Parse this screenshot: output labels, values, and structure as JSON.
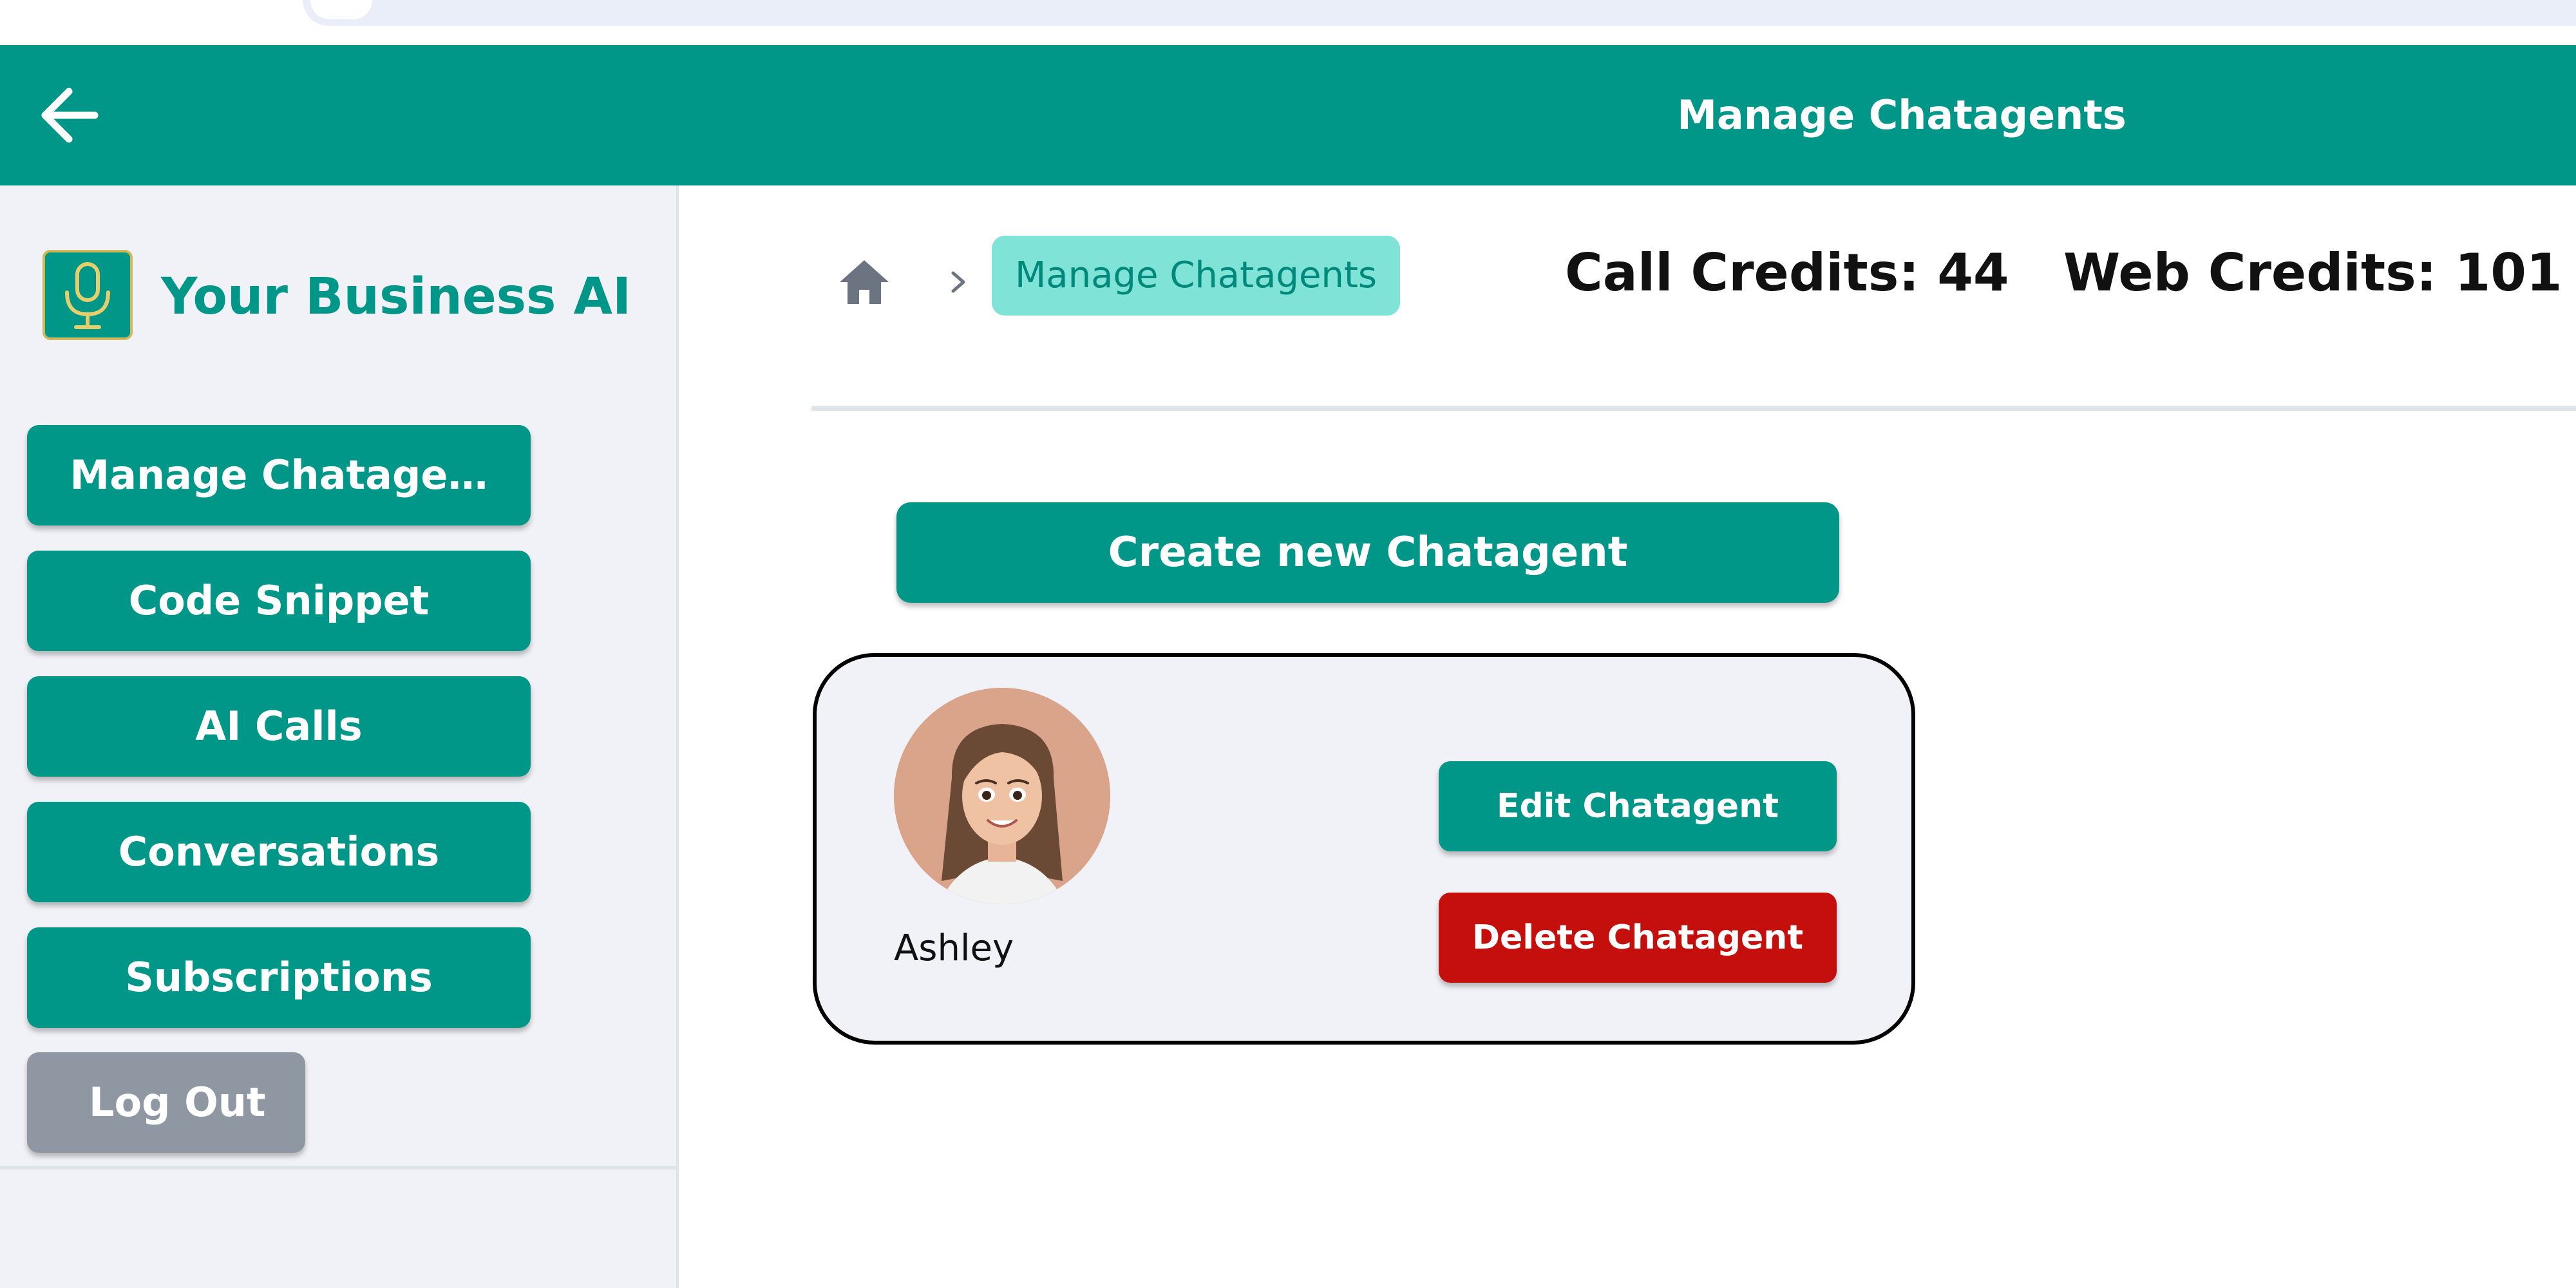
{
  "header": {
    "title": "Manage Chatagents",
    "back_icon": "arrow-left-icon",
    "background": "#009688"
  },
  "sidebar": {
    "brand": "Your Business AI",
    "logo_icon": "microphone-icon",
    "items": [
      {
        "label": "Manage Chatage…"
      },
      {
        "label": "Code Snippet"
      },
      {
        "label": "AI Calls"
      },
      {
        "label": "Conversations"
      },
      {
        "label": "Subscriptions"
      }
    ],
    "logout_label": "Log Out"
  },
  "breadcrumb": {
    "home_icon": "home-icon",
    "separator_icon": "chevron-right-icon",
    "current": "Manage Chatagents"
  },
  "credits": {
    "call": "Call Credits: 44",
    "web": "Web Credits: 101"
  },
  "main": {
    "create_label": "Create new Chatagent"
  },
  "agents": [
    {
      "name": "Ashley",
      "avatar_icon": "avatar-portrait-icon",
      "edit_label": "Edit Chatagent",
      "delete_label": "Delete Chatagent"
    }
  ],
  "colors": {
    "primary": "#009688",
    "breadcrumb_bg": "#7fe3d7",
    "danger": "#c50f0c",
    "logout": "#8e97a2",
    "sidebar_bg": "#f1f2f7"
  }
}
